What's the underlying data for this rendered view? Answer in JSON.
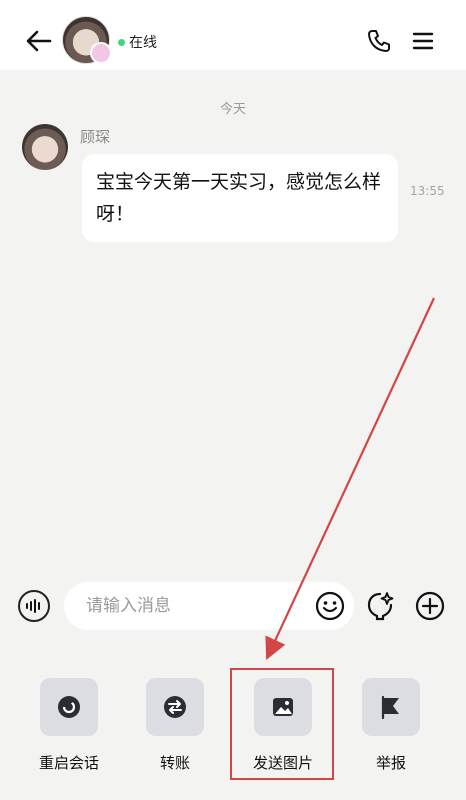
{
  "header": {
    "status_text": "在线"
  },
  "chat": {
    "date_divider": "今天",
    "messages": [
      {
        "sender": "顾琛",
        "text": "宝宝今天第一天实习，感觉怎么样呀！",
        "time": "13:55"
      }
    ]
  },
  "input": {
    "placeholder": "请输入消息"
  },
  "tools": [
    {
      "label": "重启会话",
      "icon": "restart-icon"
    },
    {
      "label": "转账",
      "icon": "transfer-icon"
    },
    {
      "label": "发送图片",
      "icon": "image-icon"
    },
    {
      "label": "举报",
      "icon": "report-icon"
    }
  ],
  "annotation": {
    "highlight_color": "#d44545",
    "highlighted_tool": "发送图片"
  }
}
